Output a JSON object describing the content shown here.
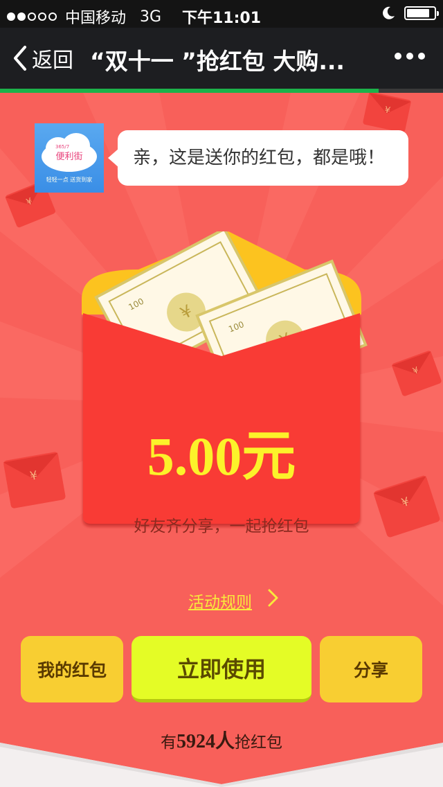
{
  "statusbar": {
    "carrier": "中国移动",
    "network": "3G",
    "time": "下午11:01",
    "signal_level": 0.4,
    "battery_level": 0.85,
    "icons": [
      "signal-dots-icon",
      "moon-icon",
      "battery-icon"
    ]
  },
  "navbar": {
    "back_label": "返回",
    "title": "“双十一 ”抢红包 大购...",
    "icons": [
      "chevron-left-icon",
      "more-dots-icon"
    ]
  },
  "page_load_progress": 0.855,
  "message": {
    "avatar_caption": "轻轻一点 送货到家",
    "avatar_brand": "便利街",
    "text": "亲，这是送你的红包，都是哦！"
  },
  "envelope": {
    "amount": "5.00元",
    "subtitle": "好友齐分享，一起抢红包",
    "bill_denomination": "100",
    "currency_symbol": "¥"
  },
  "rules_link": "活动规则",
  "buttons": {
    "my_packets": "我的红包",
    "use_now": "立即使用",
    "share": "分享"
  },
  "grab_count": {
    "prefix": "有",
    "number": "5924人",
    "suffix": "抢红包"
  },
  "colors": {
    "background": "#f8605a",
    "envelope_red": "#f93a36",
    "envelope_flap": "#fcc31f",
    "amount_yellow": "#fcf22a",
    "button_primary": "#e4fc26",
    "button_secondary": "#f8ce32",
    "progress_green": "#1cb24a"
  }
}
